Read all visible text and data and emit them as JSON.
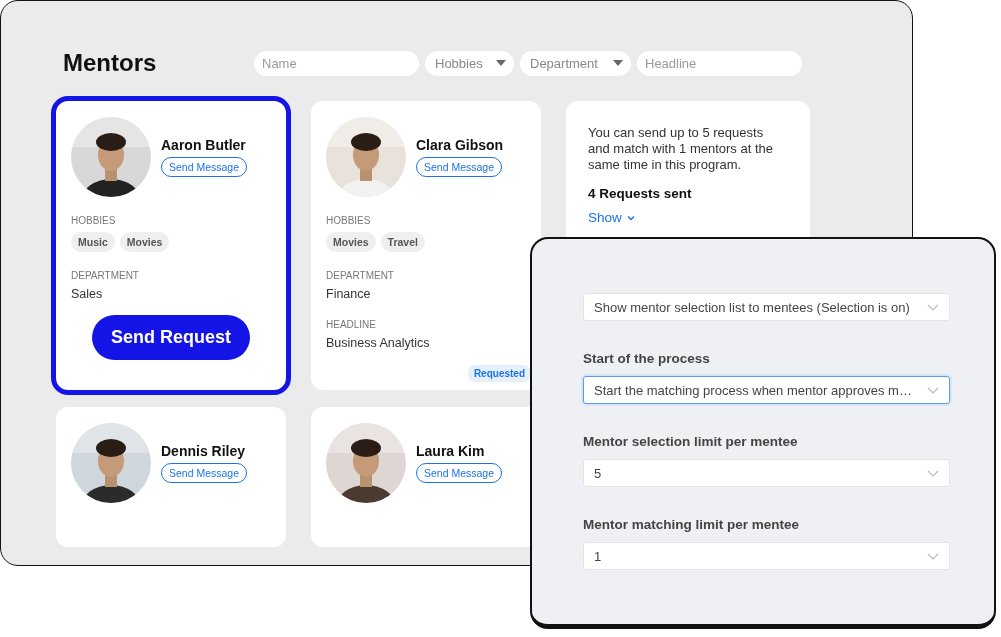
{
  "page_title": "Mentors",
  "filters": [
    {
      "kind": "text",
      "placeholder": "Name"
    },
    {
      "kind": "select",
      "label": "Hobbies"
    },
    {
      "kind": "select",
      "label": "Department"
    },
    {
      "kind": "text",
      "placeholder": "Headline"
    }
  ],
  "mentors": [
    {
      "name": "Aaron Butler",
      "selected": true,
      "action": "Send Message",
      "sections": [
        {
          "label": "HOBBIES",
          "chips": [
            "Music",
            "Movies"
          ]
        },
        {
          "label": "DEPARTMENT",
          "value": "Sales"
        }
      ],
      "button": "Send Request"
    },
    {
      "name": "Clara Gibson",
      "selected": false,
      "action": "Send Message",
      "sections": [
        {
          "label": "HOBBIES",
          "chips": [
            "Movies",
            "Travel"
          ]
        },
        {
          "label": "DEPARTMENT",
          "value": "Finance"
        },
        {
          "label": "HEADLINE",
          "value": "Business Analytics"
        }
      ],
      "badge": "Requested"
    },
    {
      "name": "Dennis Riley",
      "selected": false,
      "action": "Send Message"
    },
    {
      "name": "Laura Kim",
      "selected": false,
      "action": "Send Message"
    }
  ],
  "info": {
    "text": "You can send up to 5 requests and match with 1 mentors at the same time in this program.",
    "count": "4 Requests sent",
    "link": "Show"
  },
  "settings": [
    {
      "value": "Show mentor selection list to mentees (Selection is on)",
      "focused": false
    },
    {
      "label": "Start of the process",
      "value": "Start the matching process when mentor approves m…",
      "focused": true
    },
    {
      "label": "Mentor selection limit per mentee",
      "value": "5",
      "focused": false
    },
    {
      "label": "Mentor matching limit per mentee",
      "value": "1",
      "focused": false
    }
  ]
}
